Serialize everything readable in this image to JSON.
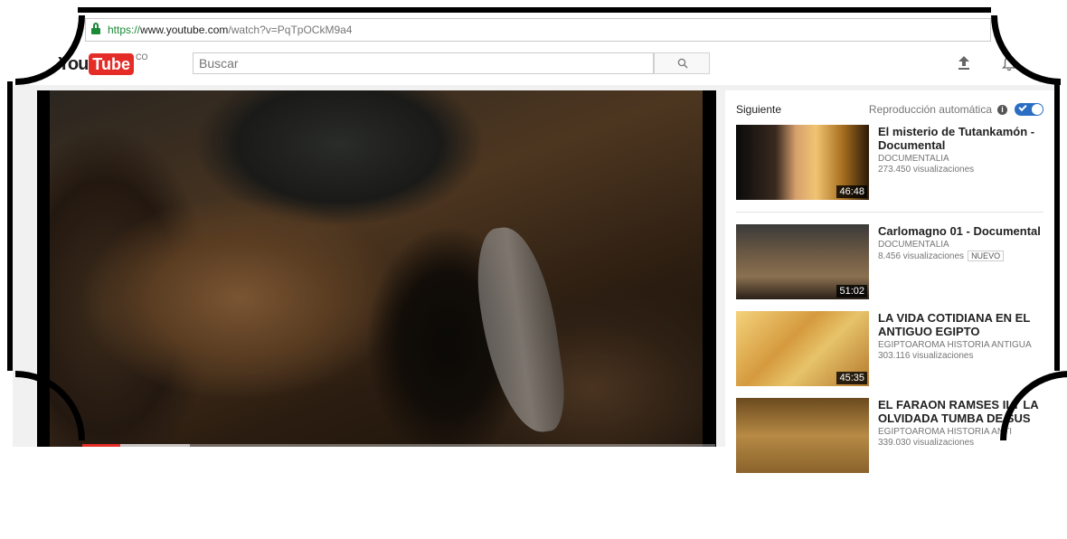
{
  "browser": {
    "url_scheme": "https://",
    "url_host": "www.youtube.com",
    "url_path": "/watch?v=PqTpOCkM9a4"
  },
  "header": {
    "logo_you": "You",
    "logo_tube": "Tube",
    "logo_country": "CO",
    "search_placeholder": "Buscar",
    "icons": [
      "search-icon",
      "upload-icon",
      "bell-icon"
    ]
  },
  "player": {
    "progress_played": 0.06,
    "progress_buffered": 0.17,
    "accent_color": "#e52d27"
  },
  "sidebar": {
    "next_label": "Siguiente",
    "autoplay_label": "Reproducción automática",
    "autoplay_on": true,
    "items": [
      {
        "title": "El misterio de Tutankamón - Documental",
        "channel": "DOCUMENTALIA",
        "views": "273.450 visualizaciones",
        "duration": "46:48",
        "badge": ""
      },
      {
        "title": "Carlomagno 01 - Documental",
        "channel": "DOCUMENTALIA",
        "views": "8.456 visualizaciones",
        "duration": "51:02",
        "badge": "NUEVO"
      },
      {
        "title": "LA VIDA COTIDIANA EN EL ANTIGUO EGIPTO",
        "channel": "EGIPTOAROMA HISTORIA ANTIGUA",
        "views": "303.116 visualizaciones",
        "duration": "45:35",
        "badge": ""
      },
      {
        "title": "EL FARAON RAMSES II Y LA OLVIDADA TUMBA DE SUS",
        "channel": "EGIPTOAROMA HISTORIA ANTI",
        "views": "339.030 visualizaciones",
        "duration": "",
        "badge": ""
      }
    ]
  }
}
